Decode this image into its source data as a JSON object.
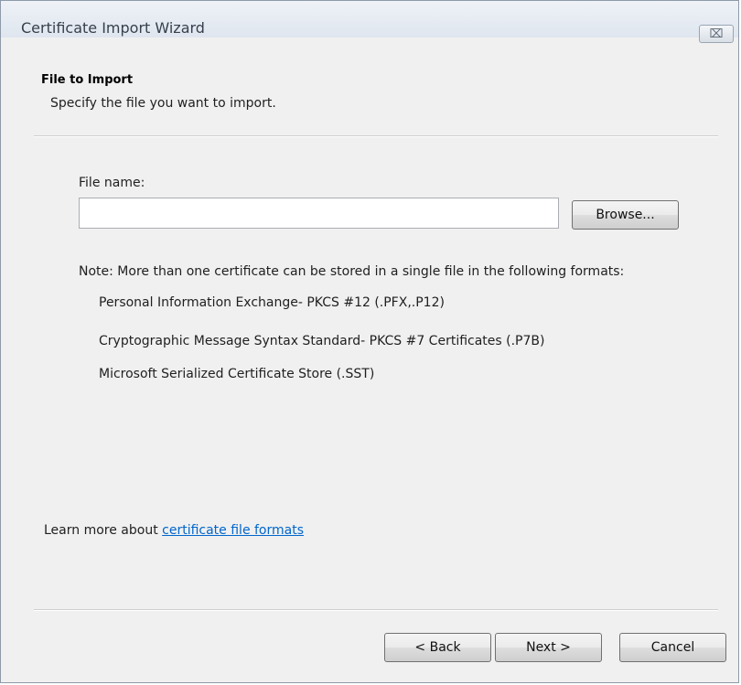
{
  "window": {
    "title": "Certificate Import Wizard",
    "close_symbol": "⌧"
  },
  "header": {
    "title": "File to Import",
    "subtitle": "Specify the file you want to import."
  },
  "form": {
    "file_name_label": "File name:",
    "file_name_value": "",
    "browse_label": "Browse..."
  },
  "note": {
    "intro": "Note:  More than one certificate can be stored in a single file in the following formats:",
    "formats": [
      "Personal Information Exchange- PKCS #12 (.PFX,.P12)",
      "Cryptographic Message Syntax Standard- PKCS #7 Certificates (.P7B)",
      "Microsoft Serialized Certificate Store (.SST)"
    ]
  },
  "learn_more": {
    "prefix": "Learn more about ",
    "link_text": "certificate file formats"
  },
  "footer": {
    "back_label": "< Back",
    "next_label": "Next >",
    "cancel_label": "Cancel"
  },
  "colors": {
    "link": "#0066cc",
    "background": "#f0f0f0"
  },
  "icons": {
    "close": "close-icon"
  }
}
